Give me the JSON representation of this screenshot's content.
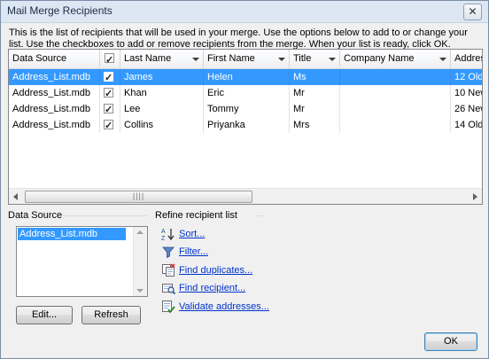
{
  "window": {
    "title": "Mail Merge Recipients",
    "close_glyph": "✕"
  },
  "intro_text": "This is the list of recipients that will be used in your merge.  Use the options below to add to or change your list.  Use the checkboxes to add or remove recipients from the merge.  When your list is ready, click OK.",
  "grid": {
    "columns": [
      "Data Source",
      "",
      "Last Name",
      "First Name",
      "Title",
      "Company Name",
      "Address"
    ],
    "rows": [
      {
        "source": "Address_List.mdb",
        "checked": true,
        "last": "James",
        "first": "Helen",
        "title": "Ms",
        "company": "",
        "address": "12 Old"
      },
      {
        "source": "Address_List.mdb",
        "checked": true,
        "last": "Khan",
        "first": "Eric",
        "title": "Mr",
        "company": "",
        "address": "10 New"
      },
      {
        "source": "Address_List.mdb",
        "checked": true,
        "last": "Lee",
        "first": "Tommy",
        "title": "Mr",
        "company": "",
        "address": "26 New"
      },
      {
        "source": "Address_List.mdb",
        "checked": true,
        "last": "Collins",
        "first": "Priyanka",
        "title": "Mrs",
        "company": "",
        "address": "14 Old"
      }
    ],
    "selected_row": 0
  },
  "data_source": {
    "label": "Data Source",
    "items": [
      "Address_List.mdb"
    ],
    "edit_label": "Edit...",
    "refresh_label": "Refresh"
  },
  "refine": {
    "label": "Refine recipient list",
    "sort": "Sort...",
    "filter": "Filter...",
    "duplicates": "Find duplicates...",
    "recipient": "Find recipient...",
    "validate": "Validate addresses..."
  },
  "ok_label": "OK"
}
